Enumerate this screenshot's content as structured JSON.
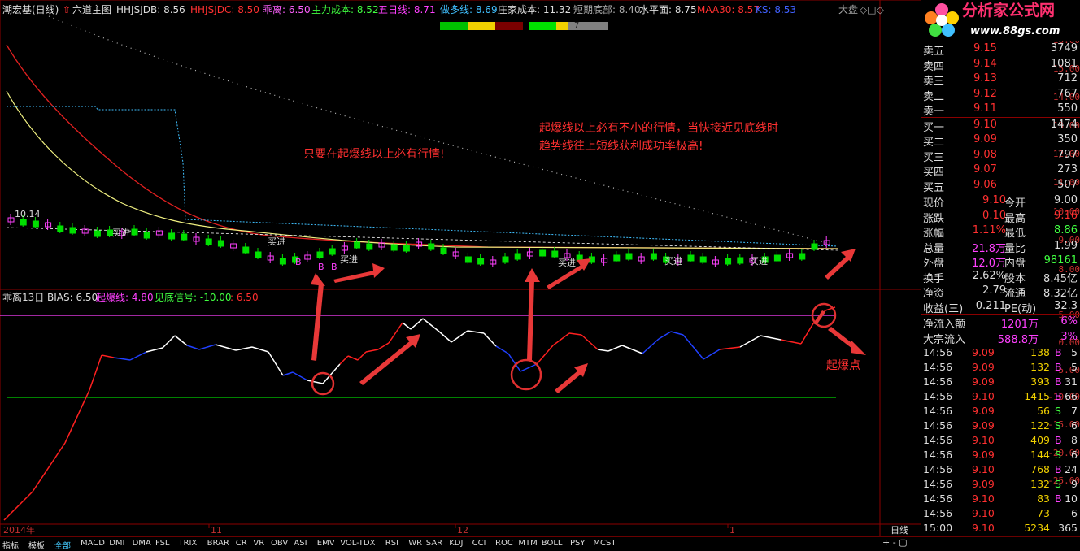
{
  "header": {
    "stock_name": "潮宏基(日线)",
    "indicator_name": "六道主图",
    "hhjsjdb": "HHJSJDB: 8.56",
    "hhjsjdc": "HHJSJDC: 8.50",
    "deviation": "乖离: 6.50",
    "main_cost": "主力成本: 8.52",
    "ma5": "五日线: 8.71",
    "long_line": "做多线: 8.69",
    "dealer_cost": "庄家成本: 11.32",
    "short_bottom": "短期底部: 8.40",
    "water_level": "水平面: 8.75",
    "maa30": "MAA30: 8.57",
    "ks": "KS: 8.53",
    "market_label": "大盘",
    "progress_number": "7"
  },
  "main_chart": {
    "price_label": "10.14",
    "note1": "只要在起爆线以上必有行情!",
    "note2_line1": "起爆线以上必有不小的行情，当快接近见底线时",
    "note2_line2": "趋势线往上短线获利成功率极高!",
    "signals": [
      "买进",
      "买进",
      "买进",
      "买进",
      "买进",
      "买进",
      "B",
      "B",
      "B"
    ],
    "axis": [
      "16.00",
      "15.00",
      "14.00",
      "13.00",
      "12.00",
      "11.00",
      "10.00",
      "9.00",
      "8.00"
    ]
  },
  "sub_chart": {
    "title": "乖离13日",
    "bias": "BIAS: 6.50",
    "explode_line": "起爆线: 4.80",
    "bottom_signal": "见底信号: -10.00",
    "bottom_value": ": 6.50",
    "annotation": "起爆点",
    "axis": [
      "5.00",
      "0.00",
      "-5.00",
      "-10.00",
      "-15.00",
      "-20.00",
      "-25.00"
    ]
  },
  "time_axis": {
    "labels": [
      "2014年",
      "11",
      "12",
      "1"
    ],
    "period": "日线"
  },
  "logo": {
    "text": "分析家公式网",
    "url_text": "www.88gs.com"
  },
  "quote": {
    "sell": [
      [
        "卖五",
        "9.15",
        "3749"
      ],
      [
        "卖四",
        "9.14",
        "1081"
      ],
      [
        "卖三",
        "9.13",
        "712"
      ],
      [
        "卖二",
        "9.12",
        "767"
      ],
      [
        "卖一",
        "9.11",
        "550"
      ]
    ],
    "buy": [
      [
        "买一",
        "9.10",
        "1474"
      ],
      [
        "买二",
        "9.09",
        "350"
      ],
      [
        "买三",
        "9.08",
        "797"
      ],
      [
        "买四",
        "9.07",
        "273"
      ],
      [
        "买五",
        "9.06",
        "507"
      ]
    ],
    "stats": [
      [
        "现价",
        "9.10",
        "今开",
        "9.00"
      ],
      [
        "涨跌",
        "0.10",
        "最高",
        "9.16"
      ],
      [
        "涨幅",
        "1.11%",
        "最低",
        "8.86"
      ],
      [
        "总量",
        "21.8万",
        "量比",
        "1.99"
      ],
      [
        "外盘",
        "12.0万",
        "内盘",
        "98161"
      ],
      [
        "换手",
        "2.62%",
        "股本",
        "8.45亿"
      ],
      [
        "净资",
        "2.79",
        "流通",
        "8.32亿"
      ],
      [
        "收益(三)",
        "0.211",
        "PE(动)",
        "32.3"
      ]
    ],
    "flow": [
      [
        "净流入额",
        "1201万",
        "6%"
      ],
      [
        "大宗流入",
        "588.8万",
        "3%"
      ]
    ],
    "ticks": [
      [
        "14:56",
        "9.09",
        "138",
        "B",
        "5"
      ],
      [
        "14:56",
        "9.09",
        "132",
        "B",
        "5"
      ],
      [
        "14:56",
        "9.09",
        "393",
        "B",
        "31"
      ],
      [
        "14:56",
        "9.10",
        "1415",
        "B",
        "66"
      ],
      [
        "14:56",
        "9.09",
        "56",
        "S",
        "7"
      ],
      [
        "14:56",
        "9.09",
        "122",
        "S",
        "6"
      ],
      [
        "14:56",
        "9.10",
        "409",
        "B",
        "8"
      ],
      [
        "14:56",
        "9.09",
        "144",
        "S",
        "6"
      ],
      [
        "14:56",
        "9.10",
        "768",
        "B",
        "24"
      ],
      [
        "14:56",
        "9.09",
        "132",
        "S",
        "9"
      ],
      [
        "14:56",
        "9.10",
        "83",
        "B",
        "10"
      ],
      [
        "14:56",
        "9.10",
        "73",
        "",
        "6"
      ],
      [
        "15:00",
        "9.10",
        "5234",
        "",
        "365"
      ]
    ]
  },
  "bottom_tabs": [
    "指标",
    "模板",
    "全部",
    "MACD",
    "DMI",
    "DMA",
    "FSL",
    "TRIX",
    "BRAR",
    "CR",
    "VR",
    "OBV",
    "ASI",
    "EMV",
    "VOL-TDX",
    "RSI",
    "WR",
    "SAR",
    "KDJ",
    "CCI",
    "ROC",
    "MTM",
    "BOLL",
    "PSY",
    "MCST"
  ],
  "colors": {
    "up": "#ff3030",
    "down": "#00e000",
    "ma_yellow": "#f0f080",
    "accent_magenta": "#ff40ff",
    "bias_white": "#ffffff",
    "bias_red": "#ff2020",
    "bias_blue": "#2040ff"
  }
}
